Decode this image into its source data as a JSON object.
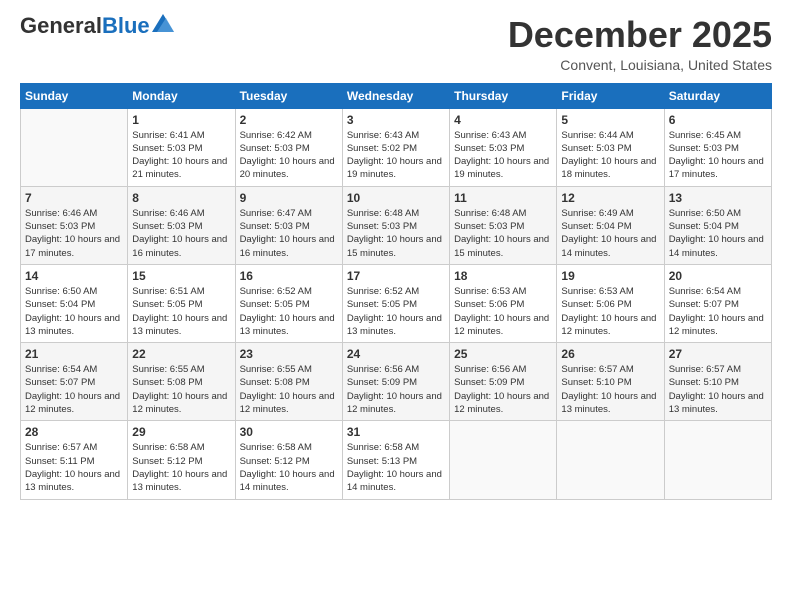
{
  "logo": {
    "general": "General",
    "blue": "Blue"
  },
  "title": "December 2025",
  "location": "Convent, Louisiana, United States",
  "days_header": [
    "Sunday",
    "Monday",
    "Tuesday",
    "Wednesday",
    "Thursday",
    "Friday",
    "Saturday"
  ],
  "weeks": [
    [
      {
        "day": "",
        "sunrise": "",
        "sunset": "",
        "daylight": ""
      },
      {
        "day": "1",
        "sunrise": "Sunrise: 6:41 AM",
        "sunset": "Sunset: 5:03 PM",
        "daylight": "Daylight: 10 hours and 21 minutes."
      },
      {
        "day": "2",
        "sunrise": "Sunrise: 6:42 AM",
        "sunset": "Sunset: 5:03 PM",
        "daylight": "Daylight: 10 hours and 20 minutes."
      },
      {
        "day": "3",
        "sunrise": "Sunrise: 6:43 AM",
        "sunset": "Sunset: 5:02 PM",
        "daylight": "Daylight: 10 hours and 19 minutes."
      },
      {
        "day": "4",
        "sunrise": "Sunrise: 6:43 AM",
        "sunset": "Sunset: 5:03 PM",
        "daylight": "Daylight: 10 hours and 19 minutes."
      },
      {
        "day": "5",
        "sunrise": "Sunrise: 6:44 AM",
        "sunset": "Sunset: 5:03 PM",
        "daylight": "Daylight: 10 hours and 18 minutes."
      },
      {
        "day": "6",
        "sunrise": "Sunrise: 6:45 AM",
        "sunset": "Sunset: 5:03 PM",
        "daylight": "Daylight: 10 hours and 17 minutes."
      }
    ],
    [
      {
        "day": "7",
        "sunrise": "Sunrise: 6:46 AM",
        "sunset": "Sunset: 5:03 PM",
        "daylight": "Daylight: 10 hours and 17 minutes."
      },
      {
        "day": "8",
        "sunrise": "Sunrise: 6:46 AM",
        "sunset": "Sunset: 5:03 PM",
        "daylight": "Daylight: 10 hours and 16 minutes."
      },
      {
        "day": "9",
        "sunrise": "Sunrise: 6:47 AM",
        "sunset": "Sunset: 5:03 PM",
        "daylight": "Daylight: 10 hours and 16 minutes."
      },
      {
        "day": "10",
        "sunrise": "Sunrise: 6:48 AM",
        "sunset": "Sunset: 5:03 PM",
        "daylight": "Daylight: 10 hours and 15 minutes."
      },
      {
        "day": "11",
        "sunrise": "Sunrise: 6:48 AM",
        "sunset": "Sunset: 5:03 PM",
        "daylight": "Daylight: 10 hours and 15 minutes."
      },
      {
        "day": "12",
        "sunrise": "Sunrise: 6:49 AM",
        "sunset": "Sunset: 5:04 PM",
        "daylight": "Daylight: 10 hours and 14 minutes."
      },
      {
        "day": "13",
        "sunrise": "Sunrise: 6:50 AM",
        "sunset": "Sunset: 5:04 PM",
        "daylight": "Daylight: 10 hours and 14 minutes."
      }
    ],
    [
      {
        "day": "14",
        "sunrise": "Sunrise: 6:50 AM",
        "sunset": "Sunset: 5:04 PM",
        "daylight": "Daylight: 10 hours and 13 minutes."
      },
      {
        "day": "15",
        "sunrise": "Sunrise: 6:51 AM",
        "sunset": "Sunset: 5:05 PM",
        "daylight": "Daylight: 10 hours and 13 minutes."
      },
      {
        "day": "16",
        "sunrise": "Sunrise: 6:52 AM",
        "sunset": "Sunset: 5:05 PM",
        "daylight": "Daylight: 10 hours and 13 minutes."
      },
      {
        "day": "17",
        "sunrise": "Sunrise: 6:52 AM",
        "sunset": "Sunset: 5:05 PM",
        "daylight": "Daylight: 10 hours and 13 minutes."
      },
      {
        "day": "18",
        "sunrise": "Sunrise: 6:53 AM",
        "sunset": "Sunset: 5:06 PM",
        "daylight": "Daylight: 10 hours and 12 minutes."
      },
      {
        "day": "19",
        "sunrise": "Sunrise: 6:53 AM",
        "sunset": "Sunset: 5:06 PM",
        "daylight": "Daylight: 10 hours and 12 minutes."
      },
      {
        "day": "20",
        "sunrise": "Sunrise: 6:54 AM",
        "sunset": "Sunset: 5:07 PM",
        "daylight": "Daylight: 10 hours and 12 minutes."
      }
    ],
    [
      {
        "day": "21",
        "sunrise": "Sunrise: 6:54 AM",
        "sunset": "Sunset: 5:07 PM",
        "daylight": "Daylight: 10 hours and 12 minutes."
      },
      {
        "day": "22",
        "sunrise": "Sunrise: 6:55 AM",
        "sunset": "Sunset: 5:08 PM",
        "daylight": "Daylight: 10 hours and 12 minutes."
      },
      {
        "day": "23",
        "sunrise": "Sunrise: 6:55 AM",
        "sunset": "Sunset: 5:08 PM",
        "daylight": "Daylight: 10 hours and 12 minutes."
      },
      {
        "day": "24",
        "sunrise": "Sunrise: 6:56 AM",
        "sunset": "Sunset: 5:09 PM",
        "daylight": "Daylight: 10 hours and 12 minutes."
      },
      {
        "day": "25",
        "sunrise": "Sunrise: 6:56 AM",
        "sunset": "Sunset: 5:09 PM",
        "daylight": "Daylight: 10 hours and 12 minutes."
      },
      {
        "day": "26",
        "sunrise": "Sunrise: 6:57 AM",
        "sunset": "Sunset: 5:10 PM",
        "daylight": "Daylight: 10 hours and 13 minutes."
      },
      {
        "day": "27",
        "sunrise": "Sunrise: 6:57 AM",
        "sunset": "Sunset: 5:10 PM",
        "daylight": "Daylight: 10 hours and 13 minutes."
      }
    ],
    [
      {
        "day": "28",
        "sunrise": "Sunrise: 6:57 AM",
        "sunset": "Sunset: 5:11 PM",
        "daylight": "Daylight: 10 hours and 13 minutes."
      },
      {
        "day": "29",
        "sunrise": "Sunrise: 6:58 AM",
        "sunset": "Sunset: 5:12 PM",
        "daylight": "Daylight: 10 hours and 13 minutes."
      },
      {
        "day": "30",
        "sunrise": "Sunrise: 6:58 AM",
        "sunset": "Sunset: 5:12 PM",
        "daylight": "Daylight: 10 hours and 14 minutes."
      },
      {
        "day": "31",
        "sunrise": "Sunrise: 6:58 AM",
        "sunset": "Sunset: 5:13 PM",
        "daylight": "Daylight: 10 hours and 14 minutes."
      },
      {
        "day": "",
        "sunrise": "",
        "sunset": "",
        "daylight": ""
      },
      {
        "day": "",
        "sunrise": "",
        "sunset": "",
        "daylight": ""
      },
      {
        "day": "",
        "sunrise": "",
        "sunset": "",
        "daylight": ""
      }
    ]
  ]
}
